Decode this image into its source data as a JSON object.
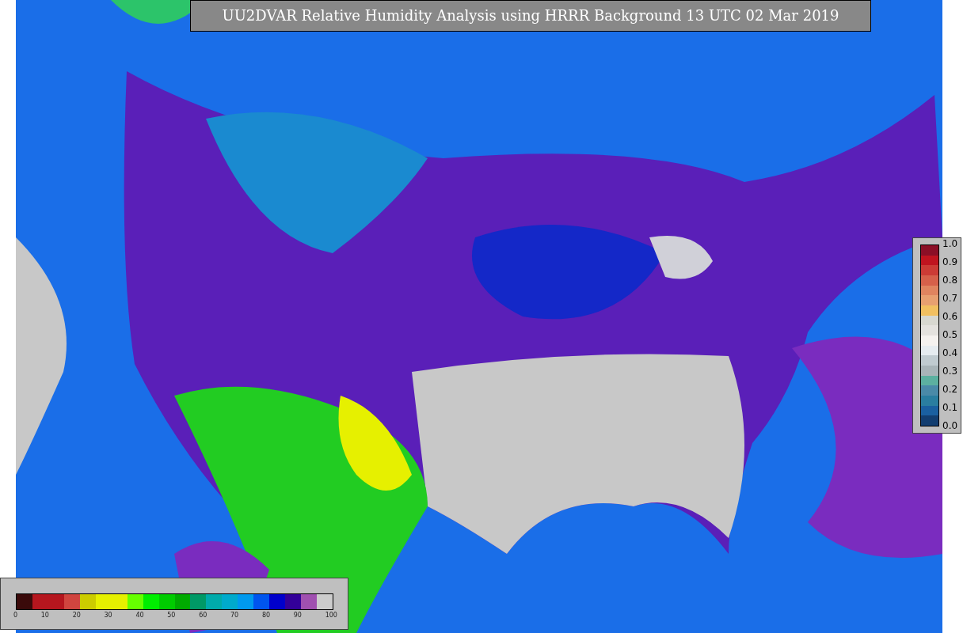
{
  "title": "UU2DVAR Relative Humidity Analysis using HRRR Background 13 UTC 02 Mar 2019",
  "obs_colorbar": {
    "ticks": [
      "1.0",
      "0.9",
      "0.8",
      "0.7",
      "0.6",
      "0.5",
      "0.4",
      "0.3",
      "0.2",
      "0.1",
      "0.0"
    ],
    "segments": [
      {
        "color": "#8b0f26"
      },
      {
        "color": "#c0141f"
      },
      {
        "color": "#cc3b35"
      },
      {
        "color": "#d6604a"
      },
      {
        "color": "#e0845f"
      },
      {
        "color": "#e8a070"
      },
      {
        "color": "#f2c060"
      },
      {
        "color": "#d8d8d0"
      },
      {
        "color": "#e4e2de"
      },
      {
        "color": "#f5f2ef"
      },
      {
        "color": "#e6ecf0"
      },
      {
        "color": "#c0cbd0"
      },
      {
        "color": "#a8b4b8"
      },
      {
        "color": "#5cb0a0"
      },
      {
        "color": "#4a8aa8"
      },
      {
        "color": "#2a7ea0"
      },
      {
        "color": "#1a60a0"
      },
      {
        "color": "#123e70"
      }
    ]
  },
  "rh_colorbar": {
    "ticks": [
      "0",
      "10",
      "20",
      "30",
      "40",
      "50",
      "60",
      "70",
      "80",
      "90",
      "100"
    ],
    "segments": [
      {
        "color": "#3a0a0a"
      },
      {
        "color": "#b5161e"
      },
      {
        "color": "#b5161e"
      },
      {
        "color": "#d0453f"
      },
      {
        "color": "#cccc00"
      },
      {
        "color": "#e6f000"
      },
      {
        "color": "#e6f000"
      },
      {
        "color": "#66ff00"
      },
      {
        "color": "#00ee00"
      },
      {
        "color": "#00cc00"
      },
      {
        "color": "#00aa00"
      },
      {
        "color": "#009966"
      },
      {
        "color": "#00aaaa"
      },
      {
        "color": "#00aacc"
      },
      {
        "color": "#0099ee"
      },
      {
        "color": "#0055ee"
      },
      {
        "color": "#0000cc"
      },
      {
        "color": "#330099"
      },
      {
        "color": "#a050b0"
      },
      {
        "color": "#cccccc"
      }
    ]
  }
}
